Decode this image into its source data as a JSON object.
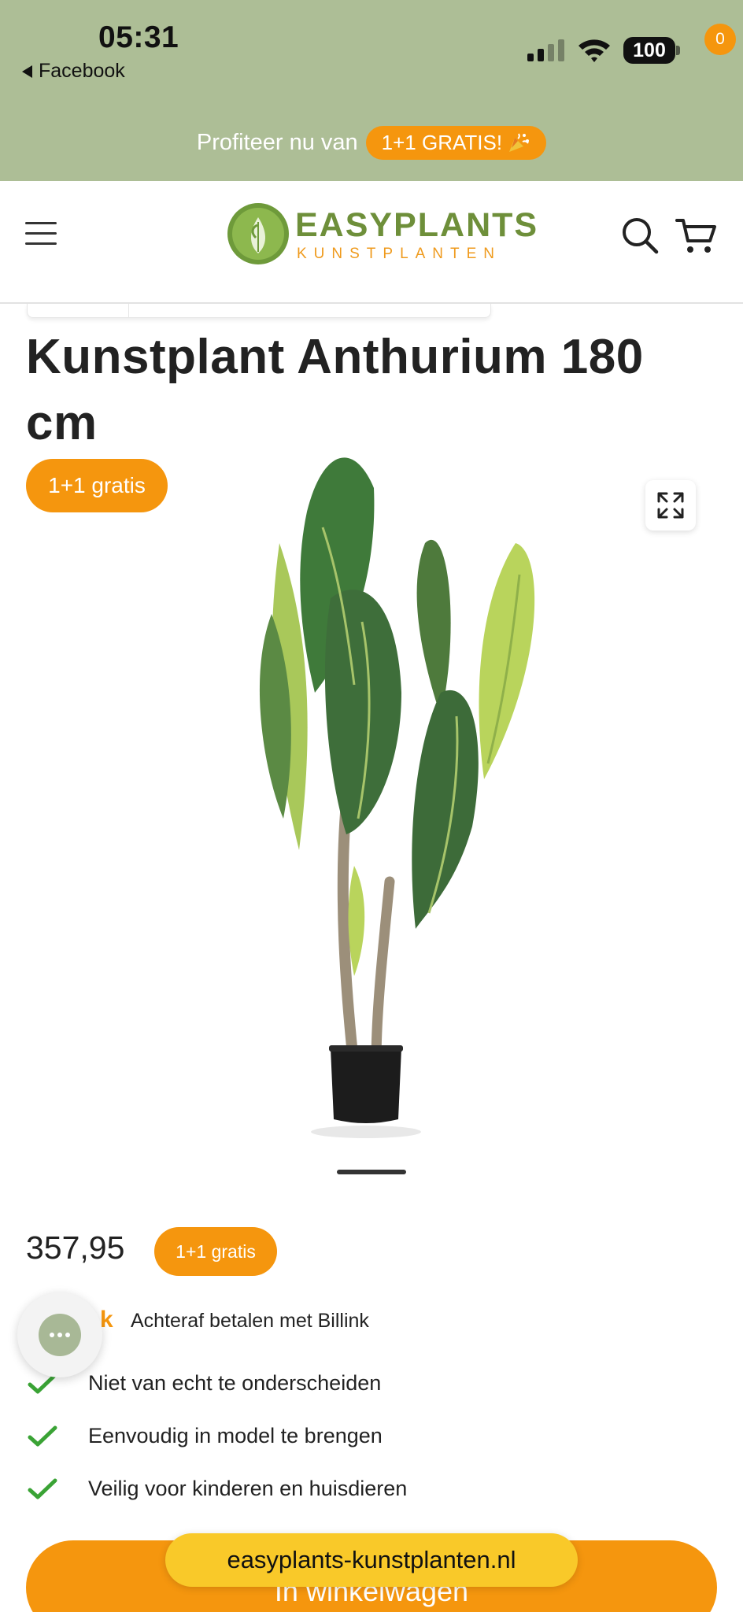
{
  "status_bar": {
    "time": "05:31",
    "back_app": "Facebook",
    "battery": "100",
    "icons": [
      "signal-icon",
      "wifi-icon",
      "battery-icon"
    ]
  },
  "promo": {
    "text": "Profiteer nu van",
    "pill": "1+1 GRATIS!",
    "pill_icon": "party-popper-icon"
  },
  "header": {
    "logo_name": "EASYPLANTS",
    "logo_sub": "KUNSTPLANTEN",
    "cart_count": "0",
    "icons": [
      "menu-icon",
      "search-icon",
      "cart-icon"
    ]
  },
  "product": {
    "title": "Kunstplant Anthurium 180 cm",
    "badge": "1+1 gratis",
    "price": "357,95",
    "price_badge": "1+1 gratis",
    "gallery_index": 1
  },
  "info": {
    "billink": "Achteraf betalen met Billink",
    "usps": [
      "Niet van echt te onderscheiden",
      "Eenvoudig in model te brengen",
      "Veilig voor kinderen en huisdieren"
    ]
  },
  "cta": {
    "label": "In winkelwagen"
  },
  "browser": {
    "url": "easyplants-kunstplanten.nl"
  },
  "colors": {
    "accent_orange": "#f5960e",
    "top_green": "#adbe96",
    "logo_green": "#6e8f3a",
    "check_green": "#3aa335",
    "url_pill_yellow": "#f9c929"
  }
}
